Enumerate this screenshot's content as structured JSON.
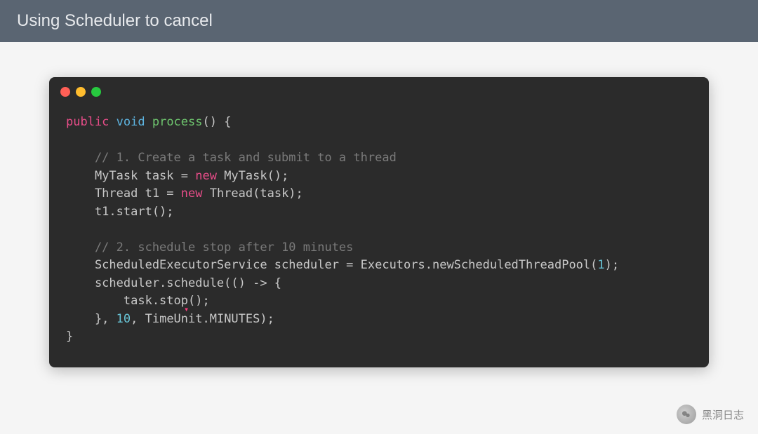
{
  "header": {
    "title": "Using Scheduler to cancel"
  },
  "code": {
    "line1_public": "public",
    "line1_void": " void",
    "line1_fn": " process",
    "line1_rest": "() {",
    "blank": "",
    "comment1": "    // 1. Create a task and submit to a thread",
    "line3a": "    MyTask task = ",
    "line3_new": "new",
    "line3b": " MyTask();",
    "line4a": "    Thread t1 = ",
    "line4_new": "new",
    "line4b": " Thread(task);",
    "line5": "    t1.start();",
    "comment2": "    // 2. schedule stop after 10 minutes",
    "line7a": "    ScheduledExecutorService scheduler = Executors.newScheduledThreadPool(",
    "line7_num": "1",
    "line7b": ");",
    "line8": "    scheduler.schedule(() -> {",
    "line9a": "        task.stop",
    "line9b": "();",
    "line10a": "    }, ",
    "line10_num": "10",
    "line10b": ", TimeUnit.MINUTES);",
    "line11": "}"
  },
  "watermark": {
    "text": "黑洞日志"
  }
}
